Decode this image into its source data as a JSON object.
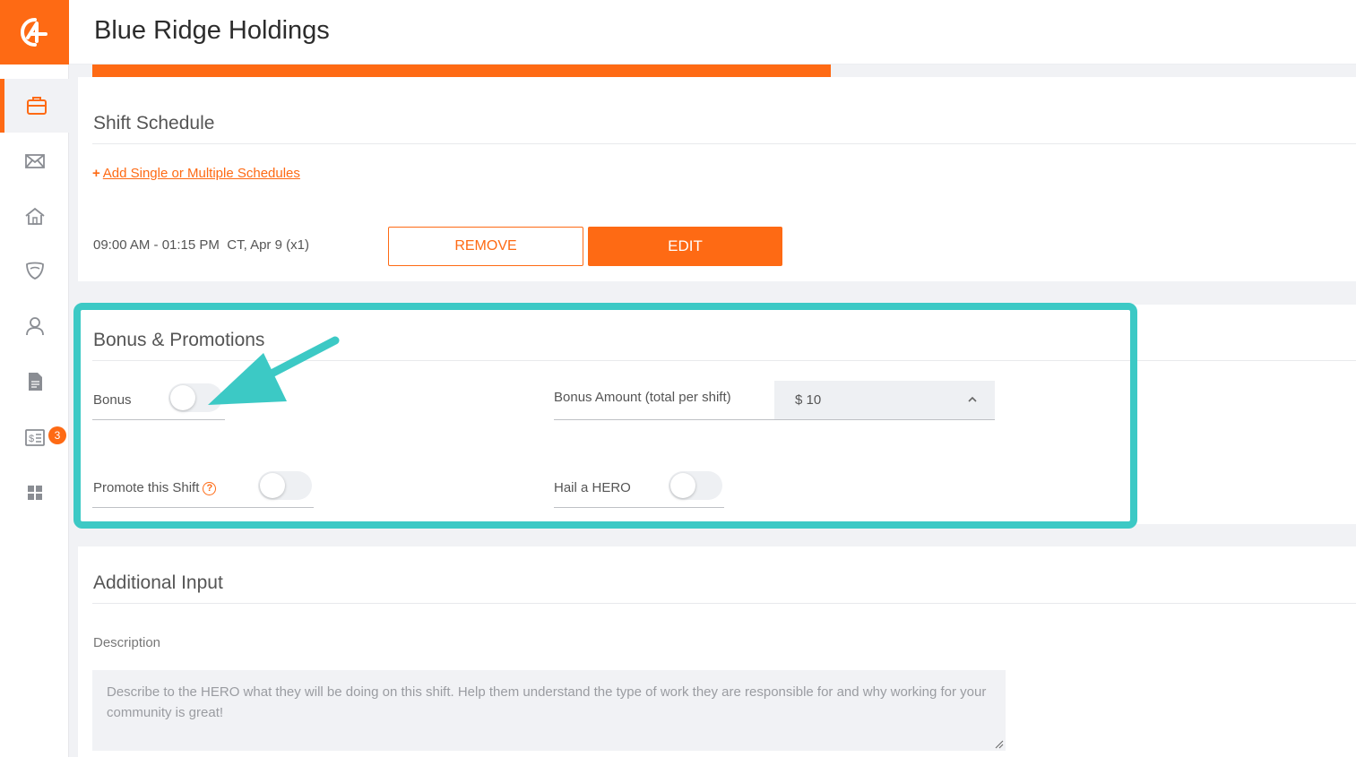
{
  "header": {
    "title": "Blue Ridge Holdings"
  },
  "sidebar": {
    "items": [
      {
        "name": "briefcase-icon",
        "active": true
      },
      {
        "name": "mail-icon"
      },
      {
        "name": "home-icon"
      },
      {
        "name": "shield-icon"
      },
      {
        "name": "user-icon"
      },
      {
        "name": "document-icon"
      },
      {
        "name": "receipt-icon",
        "badge": "3"
      },
      {
        "name": "grid-icon"
      }
    ]
  },
  "shift_schedule": {
    "title": "Shift Schedule",
    "add_link": "Add Single or Multiple Schedules",
    "add_link_icon": "+",
    "entry": "09:00 AM - 01:15 PM  CT, Apr 9 (x1)",
    "remove_label": "REMOVE",
    "edit_label": "EDIT"
  },
  "bonus": {
    "title": "Bonus & Promotions",
    "bonus_label": "Bonus",
    "bonus_on": false,
    "amount_label": "Bonus Amount (total per shift)",
    "amount_value": "$ 10",
    "promote_label": "Promote this Shift",
    "promote_help_icon": "?",
    "promote_on": false,
    "hail_label": "Hail a HERO",
    "hail_on": false
  },
  "additional": {
    "title": "Additional Input",
    "description_label": "Description",
    "description_placeholder": "Describe to the HERO what they will be doing on this shift. Help them understand the type of work they are responsible for and why working for your community is great!"
  },
  "colors": {
    "accent": "#fe6a14",
    "highlight": "#3cc9c5"
  }
}
